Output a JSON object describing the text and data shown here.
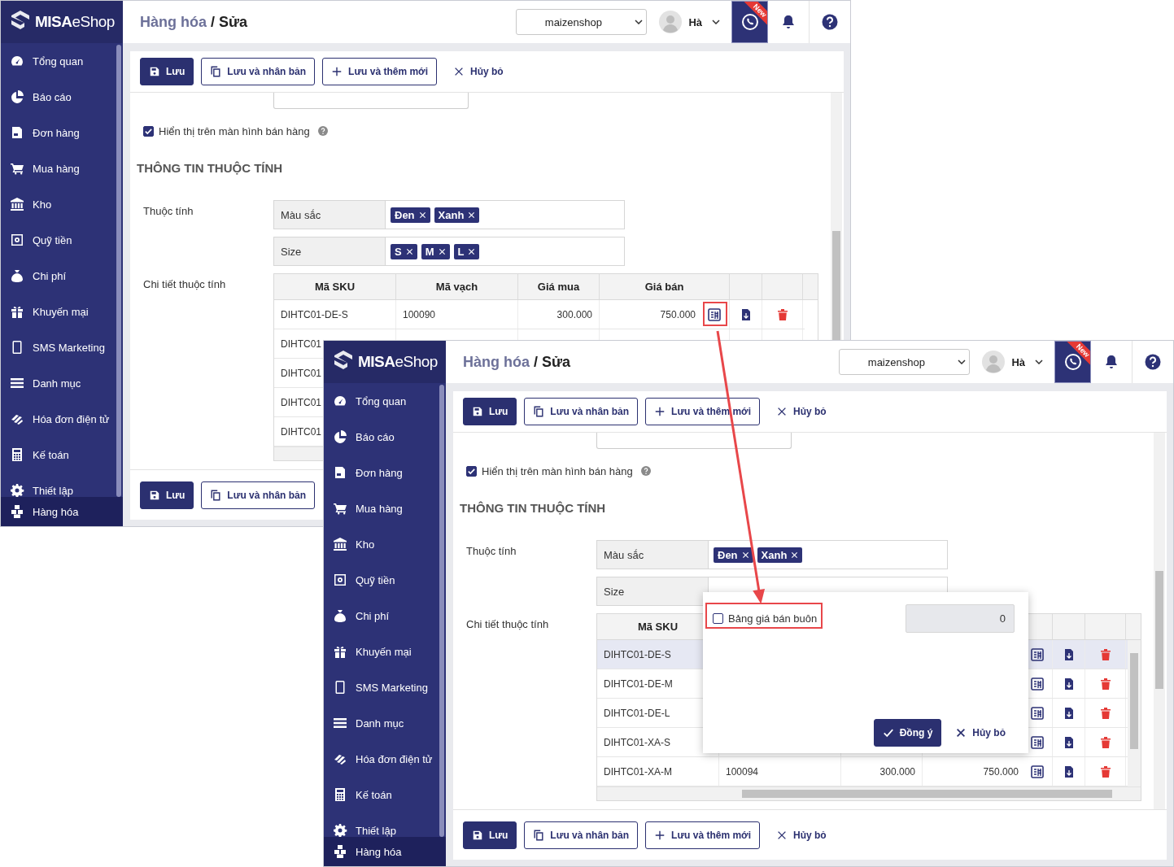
{
  "screens": [
    {
      "logo": {
        "text": "**MISA**eShop"
      },
      "sidebar": {
        "items": [
          {
            "label": "Tổng quan",
            "selected": false
          },
          {
            "label": "Báo cáo",
            "selected": false
          },
          {
            "label": "Đơn hàng",
            "selected": false
          },
          {
            "label": "Mua hàng",
            "selected": false
          },
          {
            "label": "Kho",
            "selected": false
          },
          {
            "label": "Quỹ tiền",
            "selected": false
          },
          {
            "label": "Chi phí",
            "selected": false
          },
          {
            "label": "Khuyến mại",
            "selected": false
          },
          {
            "label": "SMS Marketing",
            "selected": false
          },
          {
            "label": "Danh mục",
            "selected": false
          },
          {
            "label": "Hóa đơn điện tử",
            "selected": false
          },
          {
            "label": "Kế toán",
            "selected": false
          },
          {
            "label": "Thiết lập",
            "selected": false
          }
        ],
        "footer_item": {
          "label": "Hàng hóa",
          "selected": true
        }
      },
      "breadcrumb": {
        "parent": "Hàng hóa",
        "separator": "/",
        "current": "Sửa"
      },
      "store_select": {
        "value": "maizenshop"
      },
      "user": {
        "name": "Hà"
      },
      "support": {
        "badge": "New"
      },
      "toolbar": [
        {
          "label": "Lưu",
          "kind": "primary"
        },
        {
          "label": "Lưu và nhân bản",
          "kind": "outline"
        },
        {
          "label": "Lưu và thêm mới",
          "kind": "outline"
        },
        {
          "label": "Hủy bỏ",
          "kind": "text"
        }
      ],
      "form": {
        "show_on_sales": {
          "label": "Hiển thị trên màn hình bán hàng",
          "checked": true
        },
        "section_title": "THÔNG TIN THUỘC TÍNH",
        "attributes": {
          "label": "Thuộc tính",
          "rows": [
            {
              "name": "Màu sắc",
              "values": [
                "Đen",
                "Xanh"
              ]
            },
            {
              "name": "Size",
              "values": [
                "S",
                "M",
                "L"
              ]
            }
          ]
        },
        "details": {
          "label": "Chi tiết thuộc tính",
          "columns": [
            "Mã SKU",
            "Mã vạch",
            "Giá mua",
            "Giá bán"
          ],
          "rows": [
            {
              "sku": "DIHTC01-DE-S",
              "barcode": "100090",
              "cost": "300.000",
              "price": "750.000",
              "selected": false
            },
            {
              "sku": "DIHTC01",
              "selected": false
            },
            {
              "sku": "DIHTC01",
              "selected": false
            },
            {
              "sku": "DIHTC01",
              "selected": false
            },
            {
              "sku": "DIHTC01",
              "selected": false
            }
          ]
        }
      },
      "bottom_toolbar": [
        {
          "label": "Lưu",
          "kind": "primary"
        },
        {
          "label": "Lưu và nhân bản",
          "kind": "outline"
        }
      ]
    },
    {
      "logo": {
        "text": "**MISA**eShop"
      },
      "sidebar": {
        "items": [
          {
            "label": "Tổng quan",
            "selected": false
          },
          {
            "label": "Báo cáo",
            "selected": false
          },
          {
            "label": "Đơn hàng",
            "selected": false
          },
          {
            "label": "Mua hàng",
            "selected": false
          },
          {
            "label": "Kho",
            "selected": false
          },
          {
            "label": "Quỹ tiền",
            "selected": false
          },
          {
            "label": "Chi phí",
            "selected": false
          },
          {
            "label": "Khuyến mại",
            "selected": false
          },
          {
            "label": "SMS Marketing",
            "selected": false
          },
          {
            "label": "Danh mục",
            "selected": false
          },
          {
            "label": "Hóa đơn điện tử",
            "selected": false
          },
          {
            "label": "Kế toán",
            "selected": false
          },
          {
            "label": "Thiết lập",
            "selected": false
          }
        ],
        "footer_item": {
          "label": "Hàng hóa",
          "selected": true
        }
      },
      "breadcrumb": {
        "parent": "Hàng hóa",
        "separator": "/",
        "current": "Sửa"
      },
      "store_select": {
        "value": "maizenshop"
      },
      "user": {
        "name": "Hà"
      },
      "support": {
        "badge": "New"
      },
      "toolbar": [
        {
          "label": "Lưu",
          "kind": "primary"
        },
        {
          "label": "Lưu và nhân bản",
          "kind": "outline"
        },
        {
          "label": "Lưu và thêm mới",
          "kind": "outline"
        },
        {
          "label": "Hủy bỏ",
          "kind": "text"
        }
      ],
      "form": {
        "show_on_sales": {
          "label": "Hiển thị trên màn hình bán hàng",
          "checked": true
        },
        "section_title": "THÔNG TIN THUỘC TÍNH",
        "attributes": {
          "label": "Thuộc tính",
          "rows": [
            {
              "name": "Màu sắc",
              "values": [
                "Đen",
                "Xanh"
              ]
            },
            {
              "name": "Size"
            }
          ]
        },
        "details": {
          "label": "Chi tiết thuộc tính",
          "columns": [
            "Mã SKU"
          ],
          "rows": [
            {
              "sku": "DIHTC01-DE-S",
              "selected": true
            },
            {
              "sku": "DIHTC01-DE-M",
              "selected": false
            },
            {
              "sku": "DIHTC01-DE-L",
              "selected": false
            },
            {
              "sku": "DIHTC01-XA-S",
              "selected": false
            },
            {
              "sku": "DIHTC01-XA-M",
              "barcode": "100094",
              "cost": "300.000",
              "price": "750.000",
              "selected": false
            }
          ]
        }
      },
      "bottom_toolbar": [
        {
          "label": "Lưu",
          "kind": "primary"
        },
        {
          "label": "Lưu và nhân bản",
          "kind": "outline"
        },
        {
          "label": "Lưu và thêm mới",
          "kind": "outline"
        },
        {
          "label": "Hủy bỏ",
          "kind": "text"
        }
      ],
      "popup": {
        "checkbox": {
          "label": "Bảng giá bán buôn",
          "checked": false
        },
        "amount": {
          "value": "0",
          "disabled": true
        },
        "buttons": [
          {
            "label": "Đồng ý",
            "kind": "primary"
          },
          {
            "label": "Hủy bỏ",
            "kind": "text"
          }
        ]
      }
    }
  ]
}
